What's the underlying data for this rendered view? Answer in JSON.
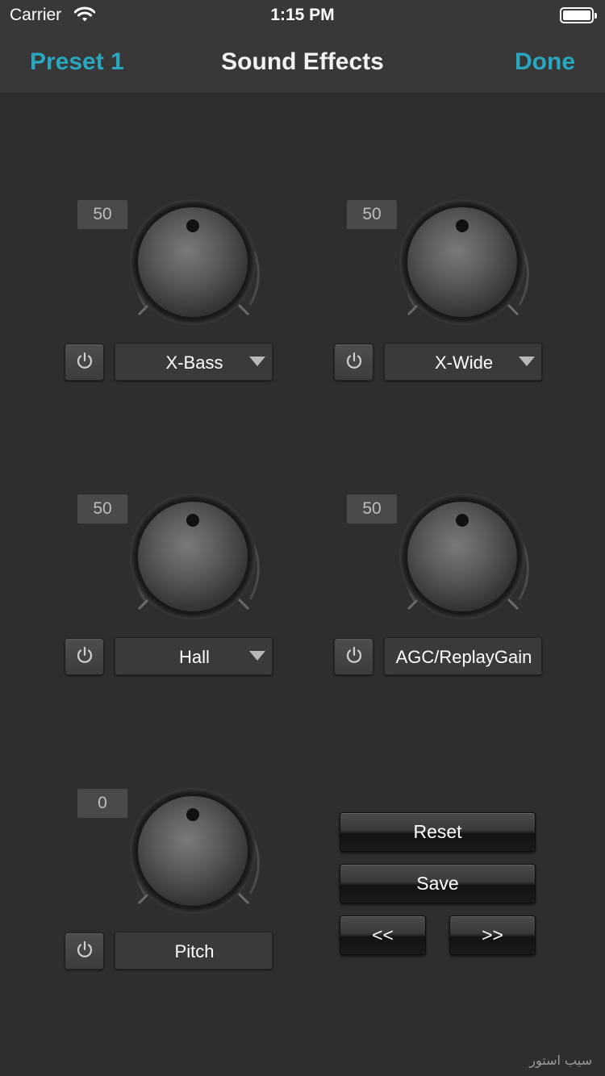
{
  "status_bar": {
    "carrier": "Carrier",
    "time": "1:15 PM"
  },
  "nav": {
    "left": "Preset 1",
    "title": "Sound Effects",
    "right": "Done"
  },
  "effects": [
    {
      "value": "50",
      "label": "X-Bass",
      "dropdown": true
    },
    {
      "value": "50",
      "label": "X-Wide",
      "dropdown": true
    },
    {
      "value": "50",
      "label": "Hall",
      "dropdown": true
    },
    {
      "value": "50",
      "label": "AGC/ReplayGain",
      "dropdown": false
    },
    {
      "value": "0",
      "label": "Pitch",
      "dropdown": false
    }
  ],
  "controls": {
    "reset": "Reset",
    "save": "Save",
    "prev": "<<",
    "next": ">>"
  },
  "watermark": "سیب استور",
  "colors": {
    "accent": "#2aa7c0",
    "background": "#2e2e2e",
    "bar": "#383838"
  },
  "icons": [
    "wifi-icon",
    "battery-icon",
    "power-icon",
    "caret-down-icon"
  ]
}
